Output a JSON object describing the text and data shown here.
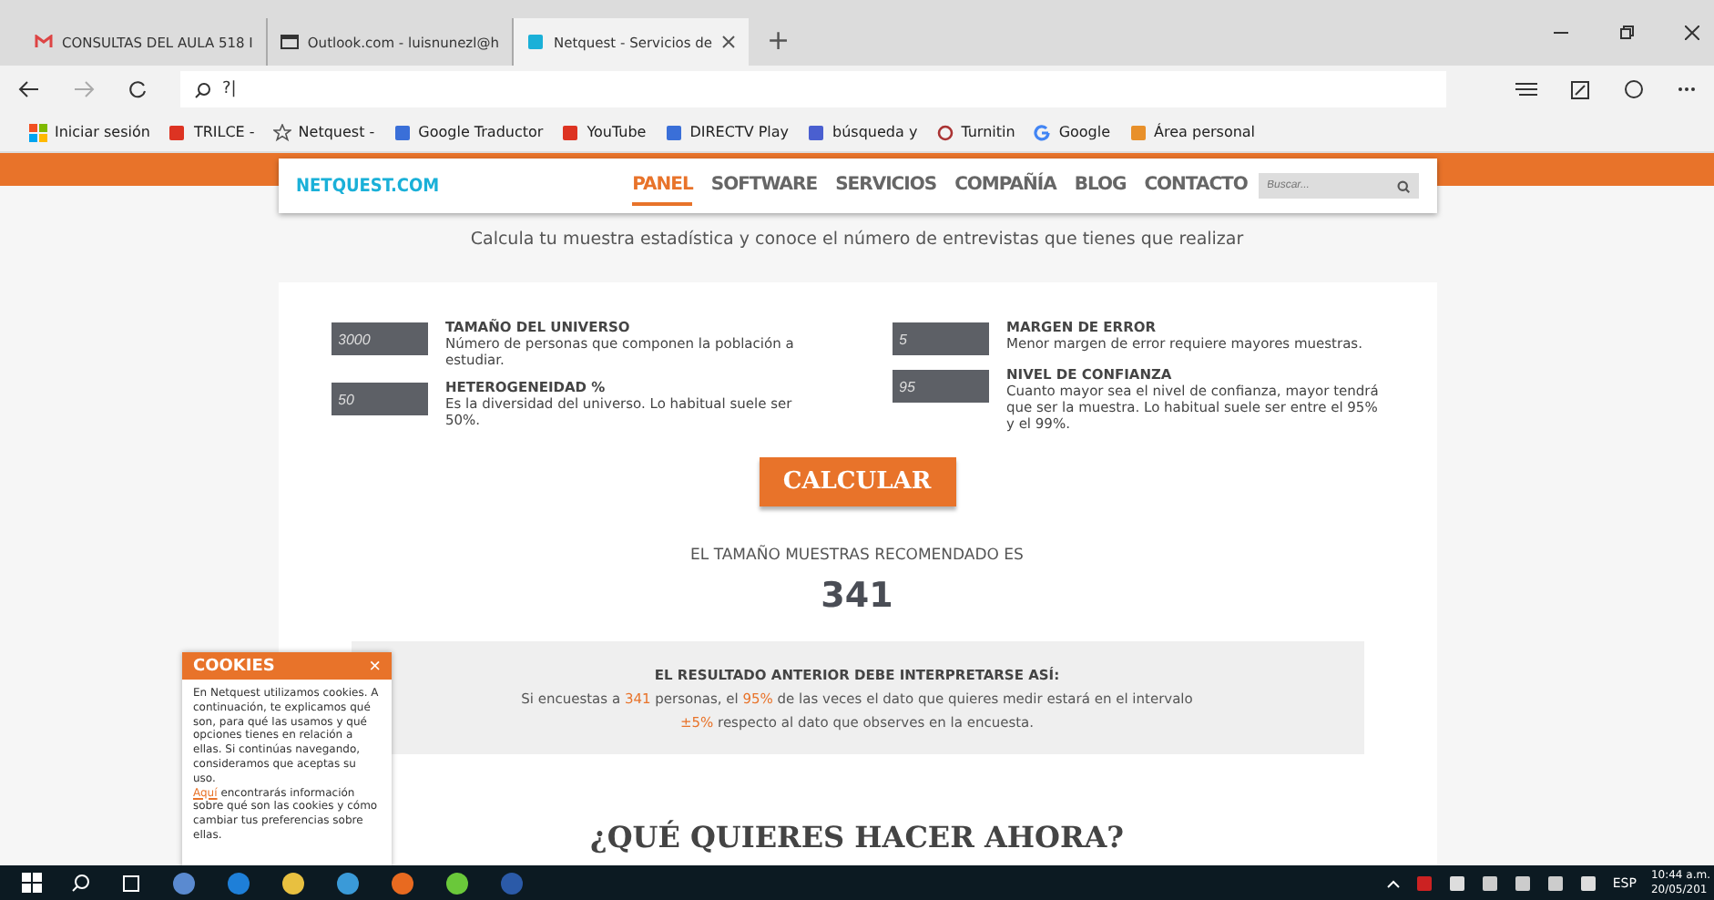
{
  "browser": {
    "tabs": [
      {
        "label": "CONSULTAS DEL AULA 518 I",
        "selected": false
      },
      {
        "label": "Outlook.com - luisnunezl@h",
        "selected": false
      },
      {
        "label": "Netquest - Servicios de",
        "selected": true
      }
    ],
    "new_tab": "+",
    "address": "?|",
    "bookmarks": [
      {
        "label": "Iniciar sesión"
      },
      {
        "label": "TRILCE -"
      },
      {
        "label": "Netquest -"
      },
      {
        "label": "Google Traductor"
      },
      {
        "label": "YouTube"
      },
      {
        "label": "DIRECTV Play"
      },
      {
        "label": "búsqueda y"
      },
      {
        "label": "Turnitin"
      },
      {
        "label": "Google"
      },
      {
        "label": "Área personal"
      }
    ]
  },
  "site": {
    "logo": "NETQUEST.COM",
    "nav": [
      {
        "label": "PANEL",
        "selected": true
      },
      {
        "label": "SOFTWARE",
        "selected": false
      },
      {
        "label": "SERVICIOS",
        "selected": false
      },
      {
        "label": "COMPAÑÍA",
        "selected": false
      },
      {
        "label": "BLOG",
        "selected": false
      },
      {
        "label": "CONTACTO",
        "selected": false
      }
    ],
    "search": {
      "placeholder": "Buscar..."
    },
    "subtitle": "Calcula tu muestra estadística y conoce el número de entrevistas que tienes que realizar",
    "field_columns": [
      [
        {
          "value": "3000",
          "title": "TAMAÑO DEL UNIVERSO",
          "description": "Número de personas que componen la población a estudiar."
        },
        {
          "value": "50",
          "title": "HETEROGENEIDAD %",
          "description": "Es la diversidad del universo. Lo habitual suele ser 50%."
        }
      ],
      [
        {
          "value": "5",
          "title": "MARGEN DE ERROR",
          "description": "Menor margen de error requiere mayores muestras."
        },
        {
          "value": "95",
          "title": "NIVEL DE CONFIANZA",
          "description": "Cuanto mayor sea el nivel de confianza, mayor tendrá que ser la muestra. Lo habitual suele ser entre el 95% y el 99%."
        }
      ]
    ],
    "button": "CALCULAR",
    "result_label": "EL TAMAÑO MUESTRAS RECOMENDADO ES",
    "result_value": "341",
    "interpretation": {
      "title": "EL RESULTADO ANTERIOR DEBE INTERPRETARSE ASÍ:",
      "lines": [
        [
          {
            "text": "Si encuestas a ",
            "highlight": false
          },
          {
            "text": "341",
            "highlight": true
          },
          {
            "text": " personas, el ",
            "highlight": false
          },
          {
            "text": "95%",
            "highlight": true
          },
          {
            "text": " de las veces el dato que quieres medir estará en el intervalo",
            "highlight": false
          }
        ],
        [
          {
            "text": "±5%",
            "highlight": true
          },
          {
            "text": " respecto al dato que observes en la encuesta.",
            "highlight": false
          }
        ]
      ]
    },
    "heading": "¿QUÉ QUIERES HACER AHORA?"
  },
  "cookies": {
    "title": "COOKIES",
    "close": "×",
    "text": "En Netquest utilizamos cookies. A continuación, te explicamos qué son, para qué las usamos y qué opciones tienes en relación a ellas. Si continúas navegando, consideramos que aceptas su uso.",
    "link": "Aquí",
    "text_after": " encontrarás información sobre qué son las cookies y cómo cambiar tus preferencias sobre ellas."
  },
  "taskbar": {
    "language": "ESP",
    "time": "10:44 a.m.",
    "date": "20/05/201"
  }
}
